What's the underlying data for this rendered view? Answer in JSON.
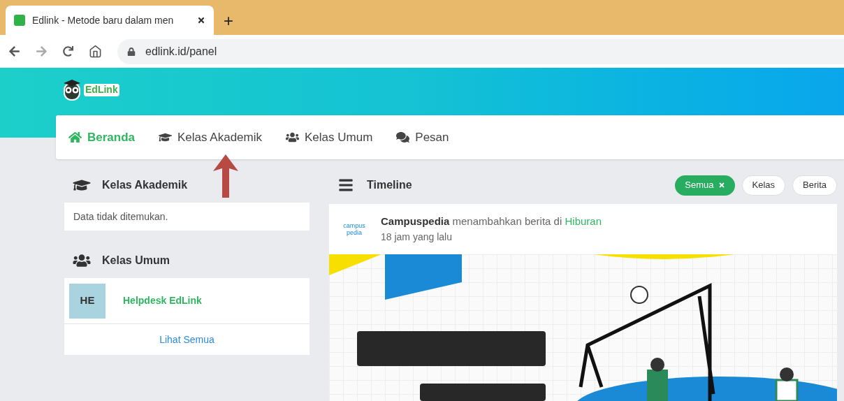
{
  "browser": {
    "tab_title": "Edlink - Metode baru dalam men",
    "new_tab": "+",
    "url": "edlink.id/panel"
  },
  "header": {
    "logo_text": "EdLink"
  },
  "nav": [
    {
      "label": "Beranda",
      "kind": "home",
      "selected": true
    },
    {
      "label": "Kelas Akademik",
      "kind": "graduation",
      "selected": false
    },
    {
      "label": "Kelas Umum",
      "kind": "users",
      "selected": false
    },
    {
      "label": "Pesan",
      "kind": "comments",
      "selected": false
    }
  ],
  "sections": [
    {
      "title": "Kelas Akademik",
      "kind": "graduation",
      "empty_message": "Data tidak ditemukan."
    },
    {
      "title": "Kelas Umum",
      "kind": "users",
      "items": [
        {
          "initials": "HE",
          "name": "Helpdesk EdLink"
        }
      ],
      "link": "Lihat Semua"
    }
  ],
  "timeline": {
    "title": "Timeline",
    "filters": [
      {
        "label": "Semua",
        "selected": true
      },
      {
        "label": "Kelas",
        "selected": false
      },
      {
        "label": "Berita",
        "selected": false
      }
    ],
    "post": {
      "author": "Campuspedia",
      "action": "menambahkan berita di",
      "category": "Hiburan",
      "time": "18 jam yang lalu",
      "avatar_text": "campus pedia"
    }
  }
}
